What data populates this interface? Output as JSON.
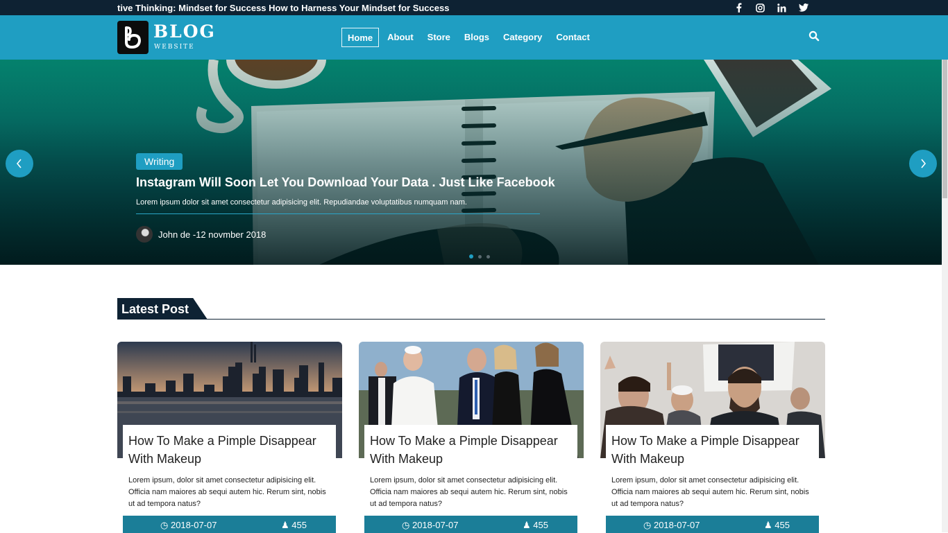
{
  "topbar": {
    "ticker": "tive Thinking: Mindset for Success How to Harness Your Mindset for Success",
    "socials": [
      "facebook-icon",
      "instagram-icon",
      "linkedin-icon",
      "twitter-icon"
    ]
  },
  "brand": {
    "title": "BLOG",
    "subtitle": "WEBSITE"
  },
  "nav": {
    "items": [
      "Home",
      "About",
      "Store",
      "Blogs",
      "Category",
      "Contact"
    ],
    "active": "Home"
  },
  "hero": {
    "badge": "Writing",
    "title": "Instagram Will Soon Let You Download Your Data . Just Like Facebook",
    "description": "Lorem ipsum dolor sit amet consectetur adipisicing elit. Repudiandae voluptatibus numquam nam.",
    "author": "John de -12 novmber 2018",
    "slide_count": 3,
    "active_slide": 1
  },
  "section": {
    "title": "Latest Post"
  },
  "posts": [
    {
      "title": "How To Make a Pimple Disappear With Makeup",
      "excerpt": "Lorem ipsum, dolor sit amet consectetur adipisicing elit. Officia nam maiores ab sequi autem hic. Rerum sint, nobis ut ad tempora natus?",
      "date": "2018-07-07",
      "views": "455"
    },
    {
      "title": "How To Make a Pimple Disappear With Makeup",
      "excerpt": "Lorem ipsum, dolor sit amet consectetur adipisicing elit. Officia nam maiores ab sequi autem hic. Rerum sint, nobis ut ad tempora natus?",
      "date": "2018-07-07",
      "views": "455"
    },
    {
      "title": "How To Make a Pimple Disappear With Makeup",
      "excerpt": "Lorem ipsum, dolor sit amet consectetur adipisicing elit. Officia nam maiores ab sequi autem hic. Rerum sint, nobis ut ad tempora natus?",
      "date": "2018-07-07",
      "views": "455"
    }
  ],
  "colors": {
    "topbar": "#0e2233",
    "accent": "#1f9ec2",
    "card_footer": "#1b7e98"
  }
}
